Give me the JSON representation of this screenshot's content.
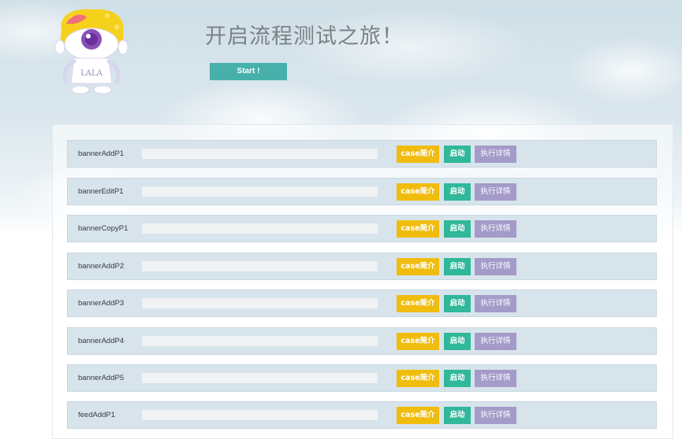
{
  "header": {
    "title": "开启流程测试之旅！",
    "start_label": "Start !",
    "mascot_text": "LALA"
  },
  "row_buttons": {
    "case_label": "case简介",
    "start_label": "启动",
    "detail_label": "执行详情"
  },
  "cases": [
    {
      "name": "bannerAddP1"
    },
    {
      "name": "bannerEditP1"
    },
    {
      "name": "bannerCopyP1"
    },
    {
      "name": "bannerAddP2"
    },
    {
      "name": "bannerAddP3"
    },
    {
      "name": "bannerAddP4"
    },
    {
      "name": "bannerAddP5"
    },
    {
      "name": "feedAddP1"
    }
  ],
  "colors": {
    "start_button": "#47b0ab",
    "case_button": "#f0bd0f",
    "run_button": "#2fb899",
    "detail_button": "#a49bc9",
    "row_background": "#d7e4ec"
  }
}
